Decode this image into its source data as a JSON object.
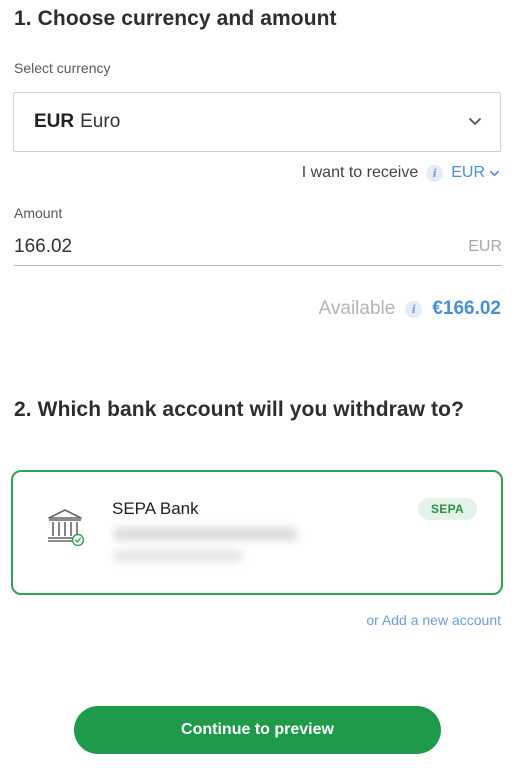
{
  "step1": {
    "title": "1. Choose currency and amount",
    "currency_label": "Select currency",
    "selected_currency": {
      "code": "EUR",
      "name": "Euro"
    },
    "receive_label": "I want to receive",
    "receive_currency": "EUR",
    "amount_label": "Amount",
    "amount_value": "166.02",
    "amount_suffix": "EUR",
    "available_label": "Available",
    "available_value": "€166.02"
  },
  "step2": {
    "title": "2. Which bank account will you withdraw to?",
    "account": {
      "name": "SEPA Bank",
      "badge": "SEPA"
    },
    "add_link": "or Add a new account"
  },
  "continue_label": "Continue to preview",
  "colors": {
    "accent_green": "#1f9a4a",
    "card_border": "#2ea44f",
    "link_blue": "#4a90d9"
  },
  "icons": [
    "chevron-down-icon",
    "info-icon",
    "bank-icon",
    "check-circle-icon"
  ]
}
